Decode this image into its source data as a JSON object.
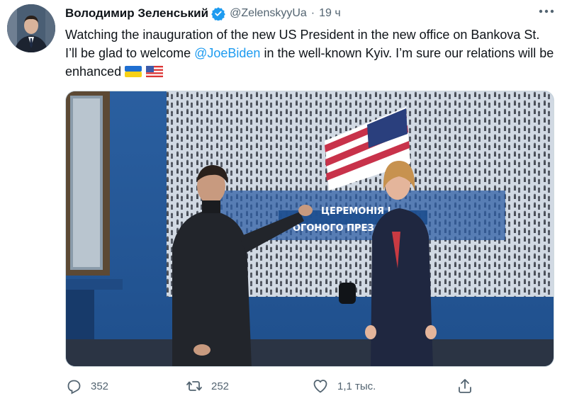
{
  "tweet": {
    "author": {
      "display_name": "Володимир Зеленський",
      "handle": "@ZelenskyyUa",
      "verified": true
    },
    "separator": "·",
    "time": "19 ч",
    "text": {
      "part1": "Watching the inauguration of the new US President in the new office on Bankova St. I’ll be glad to welcome ",
      "mention": "@JoeBiden",
      "part2": " in the well-known Kyiv. I’m sure our relations will be enhanced ",
      "emojis": [
        "flag-ukraine-icon",
        "flag-us-icon"
      ]
    },
    "media": {
      "screen_caption_line1": "ЦЕРЕМОНІЯ І",
      "screen_caption_line2": "ОГОНОГО ПРЕЗ"
    },
    "actions": {
      "reply_count": "352",
      "retweet_count": "252",
      "like_count": "1,1 тыс.",
      "share_count": ""
    }
  },
  "colors": {
    "accent": "#1d9bf0",
    "secondary_text": "#536471",
    "primary_text": "#0f1419"
  }
}
